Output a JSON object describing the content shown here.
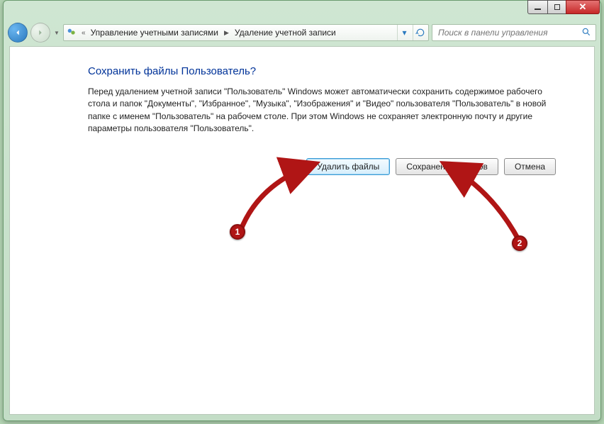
{
  "breadcrumb": {
    "level1": "Управление учетными записями",
    "level2": "Удаление учетной записи"
  },
  "search": {
    "placeholder": "Поиск в панели управления"
  },
  "page": {
    "title": "Сохранить файлы Пользователь?",
    "body": "Перед удалением учетной записи \"Пользователь\" Windows может автоматически сохранить содержимое рабочего стола и папок \"Документы\", \"Избранное\", \"Музыка\", \"Изображения\" и \"Видео\" пользователя \"Пользователь\" в новой папке с именем \"Пользователь\" на рабочем столе. При этом Windows не сохраняет электронную почту и другие параметры пользователя \"Пользователь\"."
  },
  "buttons": {
    "delete_files": "Удалить файлы",
    "keep_files": "Сохранение файлов",
    "cancel": "Отмена"
  },
  "annotations": {
    "marker1": "1",
    "marker2": "2"
  }
}
